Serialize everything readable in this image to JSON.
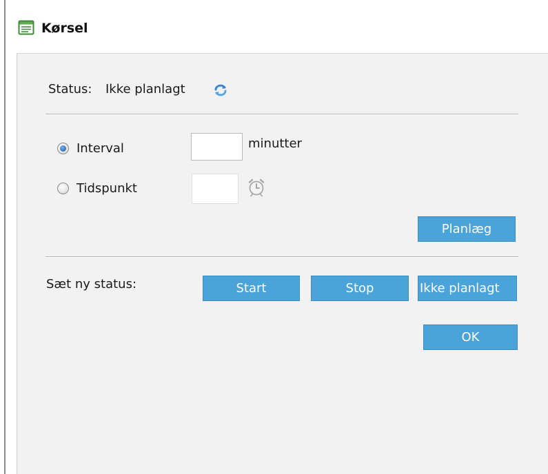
{
  "window": {
    "title": "Kørsel"
  },
  "status": {
    "label": "Status:",
    "value": "Ikke planlagt"
  },
  "schedule": {
    "interval_label": "Interval",
    "interval_value": "",
    "interval_unit": "minutter",
    "tidspunkt_label": "Tidspunkt",
    "tidspunkt_value": "",
    "selected": "Interval",
    "planlaeg_label": "Planlæg"
  },
  "set_status": {
    "label": "Sæt ny status:",
    "start_label": "Start",
    "stop_label": "Stop",
    "ikke_label": "Ikke planlagt"
  },
  "footer": {
    "ok_label": "OK"
  },
  "colors": {
    "button_bg": "#4aa3d9",
    "button_text": "#ffffff",
    "panel_bg": "#f2f2f2",
    "radio_selected": "#2d6db3"
  },
  "icons": {
    "window": "form-icon",
    "refresh": "refresh-icon",
    "time": "alarm-clock-icon"
  }
}
